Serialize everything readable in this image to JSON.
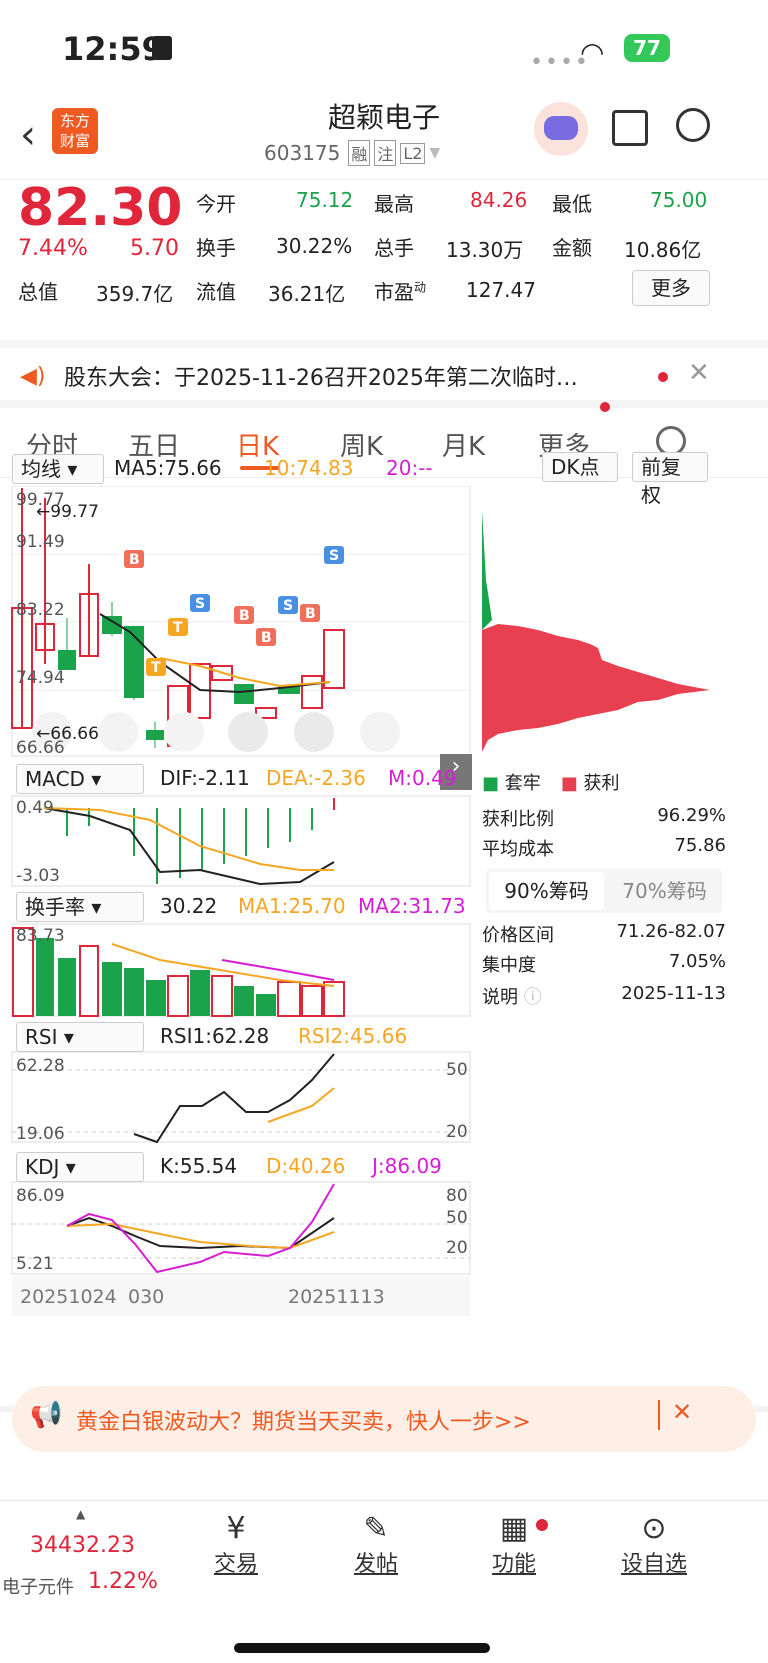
{
  "status": {
    "time": "12:59",
    "battery": "77"
  },
  "header": {
    "logo_line1": "东方",
    "logo_line2": "财富",
    "title": "超颖电子",
    "code": "603175",
    "tags": [
      "融",
      "注",
      "L2"
    ]
  },
  "quote": {
    "price": "82.30",
    "pct": "7.44%",
    "chg": "5.70",
    "open_label": "今开",
    "open": "75.12",
    "high_label": "最高",
    "high": "84.26",
    "low_label": "最低",
    "low": "75.00",
    "turnover_label": "换手",
    "turnover": "30.22%",
    "vol_label": "总手",
    "vol": "13.30万",
    "amt_label": "金额",
    "amt": "10.86亿",
    "mktcap_label": "总值",
    "mktcap": "359.7亿",
    "float_label": "流值",
    "float": "36.21亿",
    "pe_label": "市盈",
    "pe_sup": "动",
    "pe": "127.47",
    "more": "更多"
  },
  "notice": {
    "text": "股东大会：于2025-11-26召开2025年第二次临时…"
  },
  "tabs": [
    "分时",
    "五日",
    "日K",
    "周K",
    "月K",
    "更多"
  ],
  "main_chart": {
    "indicator": "均线",
    "ma5": "MA5:75.66",
    "ma10": "10:74.83",
    "ma20": "20:--",
    "dk": "DK点",
    "adjust": "前复权",
    "y_labels": [
      "99.77",
      "91.49",
      "83.22",
      "74.94",
      "66.66"
    ],
    "max_mark": "99.77",
    "min_mark": "66.66"
  },
  "macd": {
    "name": "MACD",
    "dif": "DIF:-2.11",
    "dea": "DEA:-2.36",
    "m": "M:0.49",
    "top": "0.49",
    "bottom": "-3.03"
  },
  "turn": {
    "name": "换手率",
    "v": "30.22",
    "ma1": "MA1:25.70",
    "ma2": "MA2:31.73",
    "top": "83.73"
  },
  "rsi": {
    "name": "RSI",
    "rsi1": "RSI1:62.28",
    "rsi2": "RSI2:45.66",
    "top": "62.28",
    "bottom": "19.06",
    "r50": "50",
    "r20": "20"
  },
  "kdj": {
    "name": "KDJ",
    "k": "K:55.54",
    "d": "D:40.26",
    "j": "J:86.09",
    "top": "86.09",
    "bottom": "5.21",
    "r80": "80",
    "r50": "50",
    "r20": "20"
  },
  "dates": {
    "d1": "20251024",
    "d2": "030",
    "d3": "20251113"
  },
  "chips": {
    "legend_a": "套牢",
    "legend_b": "获利",
    "profit_label": "获利比例",
    "profit": "96.29%",
    "cost_label": "平均成本",
    "cost": "75.86",
    "tab1": "90%筹码",
    "tab2": "70%筹码",
    "range_label": "价格区间",
    "range": "71.26-82.07",
    "conc_label": "集中度",
    "conc": "7.05%",
    "note_label": "说明",
    "note": "2025-11-13"
  },
  "ad": {
    "text": "黄金白银波动大？期货当天买卖，快人一步>>"
  },
  "bottom": {
    "index": "34432.23",
    "sector": "电子元件",
    "sector_pct": "1.22%",
    "trade": "交易",
    "post": "发帖",
    "func": "功能",
    "watch": "设自选"
  },
  "colors": {
    "up": "#e0263a",
    "down": "#1aa34a",
    "accent": "#ef5a23"
  }
}
